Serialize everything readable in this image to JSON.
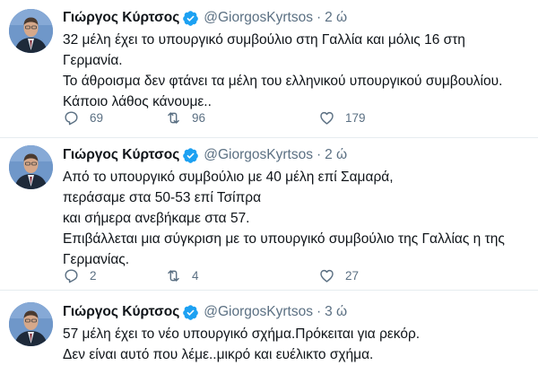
{
  "colors": {
    "accent": "#1da1f2",
    "muted": "#5b7083",
    "text": "#0f1419",
    "divider": "#e6ecf0"
  },
  "icons": {
    "verified": "verified-badge-icon",
    "reply": "reply-icon",
    "retweet": "retweet-icon",
    "like": "heart-icon"
  },
  "tweets": [
    {
      "author": "Γιώργος Κύρτσος",
      "handle": "@GiorgosKyrtsos",
      "separator": "·",
      "time": "2 ώ",
      "lines": [
        "32 μέλη έχει το υπουργικό συμβούλιο στη Γαλλία και μόλις 16 στη",
        "Γερμανία.",
        "Το άθροισμα δεν φτάνει τα μέλη του ελληνικού υπουργικού συμβουλίου.",
        "Κάποιο λάθος κάνουμε.."
      ],
      "replies": "69",
      "retweets": "96",
      "likes": "179"
    },
    {
      "author": "Γιώργος Κύρτσος",
      "handle": "@GiorgosKyrtsos",
      "separator": "·",
      "time": "2 ώ",
      "lines": [
        "Από το υπουργικό συμβούλιο με 40 μέλη επί Σαμαρά,",
        "περάσαμε στα 50-53 επί Τσίπρα",
        "και σήμερα ανεβήκαμε στα 57.",
        "Επιβάλλεται μια σύγκριση με το υπουργικό συμβούλιο της Γαλλίας η της",
        "Γερμανίας."
      ],
      "replies": "2",
      "retweets": "4",
      "likes": "27"
    },
    {
      "author": "Γιώργος Κύρτσος",
      "handle": "@GiorgosKyrtsos",
      "separator": "·",
      "time": "3 ώ",
      "lines": [
        "57 μέλη έχει το νέο υπουργικό σχήμα.Πρόκειται για ρεκόρ.",
        "Δεν είναι αυτό που λέμε..μικρό και ευέλικτο σχήμα."
      ]
    }
  ]
}
